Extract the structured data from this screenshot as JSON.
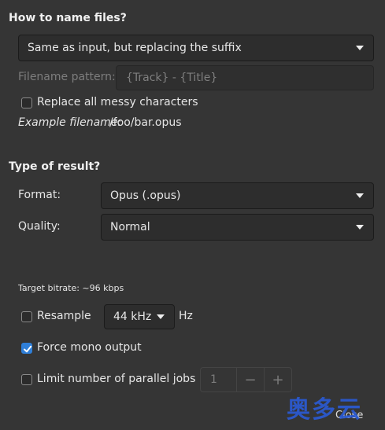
{
  "naming": {
    "heading": "How to name files?",
    "mode_selected": "Same as input, but replacing the suffix",
    "pattern_label": "Filename pattern:",
    "pattern_placeholder": "{Track} - {Title}",
    "replace_messy_label": "Replace all messy characters",
    "replace_messy_checked": false,
    "example_label": "Example filename:",
    "example_value": "/foo/bar.opus"
  },
  "result": {
    "heading": "Type of result?",
    "format_label": "Format:",
    "format_selected": "Opus (.opus)",
    "quality_label": "Quality:",
    "quality_selected": "Normal",
    "target_bitrate": "Target bitrate: ~96 kbps",
    "resample_label": "Resample",
    "resample_checked": false,
    "resample_rate": "44 kHz",
    "resample_unit": "Hz",
    "force_mono_label": "Force mono output",
    "force_mono_checked": true,
    "limit_jobs_label": "Limit number of parallel jobs",
    "limit_jobs_checked": false,
    "jobs_value": "1",
    "jobs_minus": "−",
    "jobs_plus": "+"
  },
  "footer": {
    "close_label": "Close",
    "watermark": "奥多云"
  },
  "colors": {
    "background": "#353535",
    "accent": "#2f7fd8",
    "watermark": "#2a5bd6"
  }
}
